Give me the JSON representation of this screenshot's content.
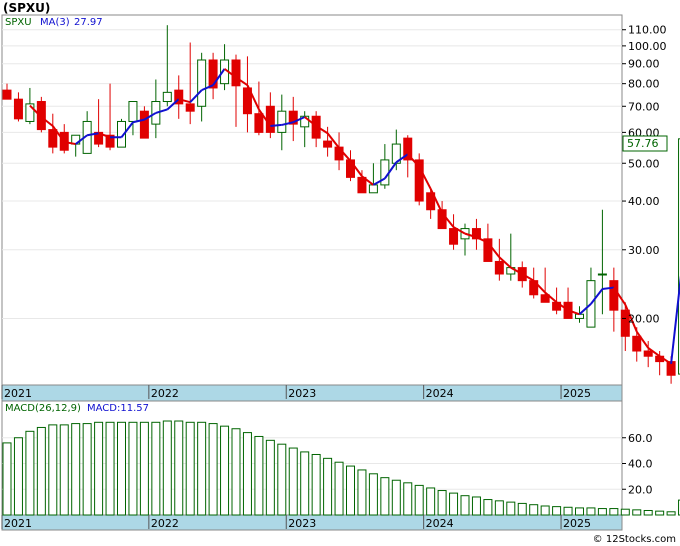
{
  "title": "(SPXU)",
  "footer": "© 12Stocks.com",
  "price_panel": {
    "legend_symbol": "SPXU",
    "legend_ma": "MA(3)",
    "legend_ma_value": "27.97",
    "last_price": "57.76",
    "y_ticks": [
      "110.00",
      "100.00",
      "90.00",
      "80.00",
      "70.00",
      "60.00",
      "50.00",
      "40.00",
      "30.00",
      "20.00"
    ]
  },
  "macd_panel": {
    "legend_macd": "MACD(26,12,9)",
    "legend_macd_value": "MACD:11.57",
    "y_ticks": [
      "60.0",
      "40.0",
      "20.0"
    ]
  },
  "x_labels": [
    "2021",
    "2022",
    "2023",
    "2024",
    "2025"
  ],
  "colors": {
    "up": "#006400",
    "down": "#e00000",
    "ma_up": "#1010d0",
    "ma_down": "#e00000",
    "axis_band": "#add8e6",
    "macd": "#006400"
  },
  "chart_data": [
    {
      "type": "candlestick",
      "title": "",
      "scale": "log",
      "ylim": [
        13.5,
        120
      ],
      "x": [
        "2020-12",
        "2021-01",
        "2021-02",
        "2021-03",
        "2021-04",
        "2021-05",
        "2021-06",
        "2021-07",
        "2021-08",
        "2021-09",
        "2021-10",
        "2021-11",
        "2021-12",
        "2022-01",
        "2022-02",
        "2022-03",
        "2022-04",
        "2022-05",
        "2022-06",
        "2022-07",
        "2022-08",
        "2022-09",
        "2022-10",
        "2022-11",
        "2022-12",
        "2023-01",
        "2023-02",
        "2023-03",
        "2023-04",
        "2023-05",
        "2023-06",
        "2023-07",
        "2023-08",
        "2023-09",
        "2023-10",
        "2023-11",
        "2023-12",
        "2024-01",
        "2024-02",
        "2024-03",
        "2024-04",
        "2024-05",
        "2024-06",
        "2024-07",
        "2024-08",
        "2024-09",
        "2024-10",
        "2024-11",
        "2024-12",
        "2025-01",
        "2025-02",
        "2025-03",
        "2025-04",
        "2025-05",
        "2025-06",
        "2025-07",
        "2025-08",
        "2025-09",
        "2025-10",
        "2025-11"
      ],
      "open": [
        77,
        73,
        64,
        72,
        61,
        60,
        56,
        53,
        60,
        59,
        55,
        64,
        68,
        63,
        72,
        77,
        71,
        70,
        92,
        80,
        92,
        78,
        67,
        70,
        60,
        68,
        62,
        66,
        57,
        55,
        51,
        46,
        42,
        44,
        50,
        58,
        51,
        42,
        38,
        34,
        32,
        34,
        32,
        28,
        26,
        27,
        25,
        23,
        22,
        22,
        20,
        19,
        26,
        25,
        21,
        18,
        16.5,
        16,
        15.5,
        14.4
      ],
      "high": [
        80,
        76,
        78,
        74,
        67,
        63,
        58,
        68,
        73,
        80,
        65,
        72,
        70,
        82,
        113,
        84,
        102,
        96,
        96,
        101,
        95,
        94,
        81,
        76,
        75,
        74,
        68,
        68,
        62,
        60,
        54,
        48,
        50,
        56,
        61,
        59,
        53,
        43,
        40,
        37,
        35,
        36,
        35,
        32,
        33,
        28,
        27,
        27,
        24,
        24,
        21.5,
        27,
        38,
        27,
        22,
        19,
        17.5,
        16.5,
        16,
        57.8
      ],
      "low": [
        73,
        64,
        63,
        60,
        53,
        53,
        52,
        54,
        55,
        54,
        55,
        59,
        58,
        58,
        70,
        65,
        63,
        64,
        73,
        77,
        62,
        60,
        59,
        58,
        54,
        57,
        55,
        55,
        52,
        48,
        45,
        42,
        42,
        43,
        48,
        46,
        39,
        36,
        34,
        30,
        29,
        30,
        29,
        25,
        25,
        24,
        22.5,
        22,
        20.5,
        20,
        19.5,
        19,
        20.5,
        18.5,
        16.5,
        15.5,
        15,
        14.3,
        13.6,
        13.5
      ],
      "close": [
        73,
        65,
        71,
        61,
        55,
        54,
        59,
        64,
        56,
        55,
        64,
        72,
        58,
        72,
        76,
        71,
        68,
        92,
        78,
        92,
        79,
        67,
        60,
        60,
        68,
        63,
        66,
        58,
        55,
        51,
        46,
        42,
        44,
        51,
        56,
        51,
        40,
        38,
        34,
        31,
        34,
        32,
        28,
        26,
        27,
        25,
        23,
        22,
        21,
        20,
        20.5,
        25,
        26,
        21,
        18,
        16.5,
        16,
        15.5,
        14.3,
        57.76
      ],
      "ma3": [
        null,
        null,
        70.3,
        65.7,
        62.3,
        56.7,
        56.0,
        59.0,
        59.7,
        58.3,
        58.3,
        63.7,
        64.7,
        67.3,
        68.7,
        73.0,
        71.7,
        77.0,
        79.3,
        87.3,
        83.0,
        79.3,
        68.7,
        62.3,
        62.7,
        63.7,
        65.7,
        62.3,
        59.7,
        54.7,
        50.7,
        46.3,
        44.0,
        45.7,
        50.3,
        52.7,
        49.0,
        43.0,
        37.3,
        34.3,
        33.0,
        32.3,
        31.3,
        28.7,
        27.0,
        26.0,
        25.0,
        23.3,
        22.0,
        21.0,
        20.5,
        21.8,
        23.8,
        24.0,
        21.7,
        18.5,
        16.8,
        16.0,
        15.3,
        27.97
      ],
      "ylabel": ""
    },
    {
      "type": "bar",
      "title": "",
      "ylim": [
        0,
        80
      ],
      "values": [
        56,
        60,
        65,
        68,
        70,
        70,
        71,
        71,
        72,
        72,
        72,
        72,
        72,
        72,
        73,
        73,
        72,
        72,
        71,
        69,
        67,
        64,
        61,
        58,
        55,
        52,
        49,
        47,
        44,
        41,
        38,
        35,
        32,
        29,
        27,
        25,
        23,
        21,
        19,
        17,
        15,
        14,
        12,
        11,
        10,
        9,
        8,
        7,
        6.5,
        6,
        5.5,
        5.5,
        5,
        5,
        4.5,
        4,
        3.5,
        3,
        2.5,
        11.57
      ],
      "ylabel": ""
    }
  ]
}
